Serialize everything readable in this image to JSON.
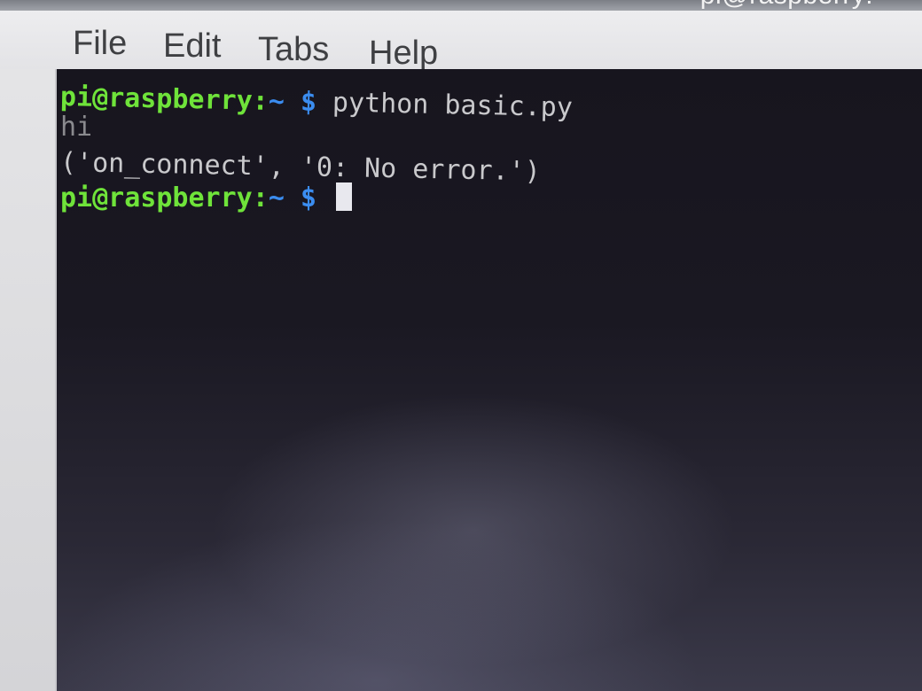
{
  "window": {
    "title": "pi@raspberry: ~"
  },
  "menubar": {
    "items": [
      {
        "label": "File"
      },
      {
        "label": "Edit"
      },
      {
        "label": "Tabs"
      },
      {
        "label": "Help"
      }
    ]
  },
  "terminal": {
    "lines": [
      {
        "user_host": "pi@raspberry",
        "colon": ":",
        "path": "~",
        "prompt": " $ ",
        "command": "python basic.py"
      },
      {
        "output": "hi"
      },
      {
        "output": "('on_connect', '0: No error.')"
      },
      {
        "user_host": "pi@raspberry",
        "colon": ":",
        "path": "~",
        "prompt": " $ ",
        "command": ""
      }
    ]
  },
  "colors": {
    "user_host": "#6fe33a",
    "path_prompt": "#3b8df0",
    "output_text": "#c9c9cc",
    "terminal_background": "#17151e"
  }
}
